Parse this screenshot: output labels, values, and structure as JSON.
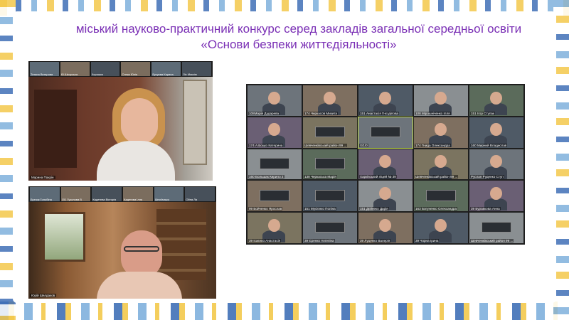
{
  "title": {
    "line1": "міський науково-практичний конкурс серед закладів загальної середньої освіти",
    "line2": "«Основи безпеки життєдіяльності»"
  },
  "video_a": {
    "strip": [
      "Тетяна Вегерова",
      "Ю.Шкорська",
      "Хорошко",
      "Стежк Юлія",
      "Бусуєва Карина",
      "Ліс Максім"
    ],
    "self_label": "Марина Пахрін"
  },
  "video_b": {
    "strip": [
      "Бутчик Голобіна",
      "151 Гуколова В",
      "Кадетєва Вікторія",
      "Кадетєва Ілля",
      "Шпиґалько",
      "Ойна Ля"
    ],
    "self_label": "Юрій Шелдаков"
  },
  "gallery": {
    "tiles": [
      "108Марія Дударева",
      "174 Черкасов Микита",
      "151 Анастасія Гнєздіпова",
      "108 Мірошніченко Ілля",
      "151 Ігор Ступак",
      "174 А.Боцко Катерина",
      "Шевченківський район 99 ...",
      "Х/1/0",
      "174 Гнида Олександра",
      "160 Мирний Владислав",
      "160 Большак Кирило 2",
      "138 Черкаська Марія",
      "Харківський ліцей № 39",
      "Шевченківський район 99 ...",
      "Руслан Руденко Ступ",
      "99 Бойченко Ярослав",
      "151 Мусієнко Поліна",
      "151 Дєйнеко Дарія",
      "163 Богуненко Олександра",
      "39 Буравкова Анна",
      "39 Ісаєнко Анастасія",
      "39 Єренко Ангеліна",
      "39 Луценко Валерія",
      "39 Чорна Ірина",
      "Шевченківський район 99 ..."
    ]
  },
  "colors": {
    "title": "#7a2fb5",
    "frame_blue": "#3f6fb6",
    "frame_yellow": "#f3c84b",
    "active_speaker": "#c6e24a"
  }
}
